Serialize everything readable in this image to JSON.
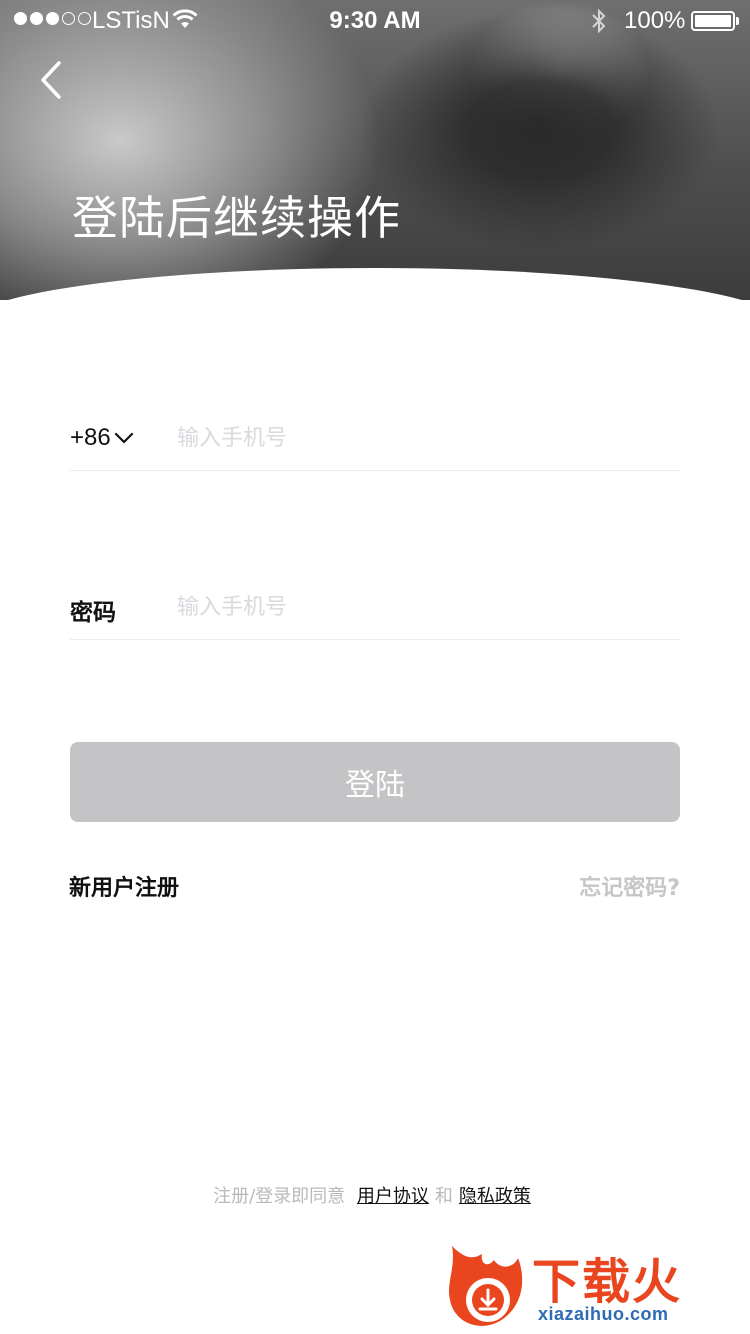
{
  "status_bar": {
    "carrier": "LSTisN",
    "time": "9:30 AM",
    "battery": "100%"
  },
  "header": {
    "title": "登陆后继续操作"
  },
  "form": {
    "country_code": "+86",
    "phone_placeholder": "输入手机号",
    "password_label": "密码",
    "password_placeholder": "输入手机号",
    "login_label": "登陆"
  },
  "links": {
    "register": "新用户注册",
    "forgot": "忘记密码?"
  },
  "agreement": {
    "prefix": "注册/登录即同意",
    "terms": "用户协议",
    "and": "和",
    "privacy": "隐私政策"
  },
  "watermark": {
    "title": "下载火",
    "url": "xiazaihuo.com"
  },
  "colors": {
    "login_button_disabled": "#c4c3c6",
    "placeholder": "#d9d9de",
    "watermark_orange": "#e9461f",
    "watermark_blue": "#2d6cb5"
  }
}
